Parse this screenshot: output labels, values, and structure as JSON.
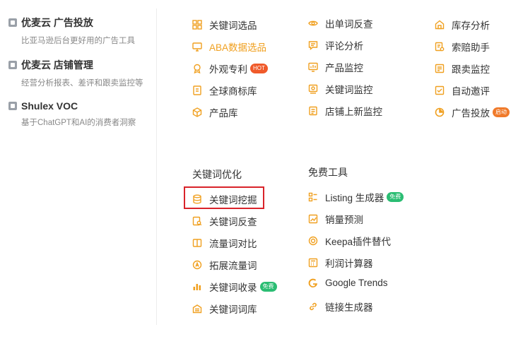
{
  "left_products": [
    {
      "name": "优麦云 广告投放",
      "desc": "比亚马逊后台更好用的广告工具",
      "icon": "u-logo-icon"
    },
    {
      "name": "优麦云 店铺管理",
      "desc": "经营分析报表、差评和跟卖监控等",
      "icon": "store-icon"
    },
    {
      "name": "Shulex VOC",
      "desc": "基于ChatGPT和AI的消费者洞察",
      "icon": "voc-icon"
    }
  ],
  "menu_col1": [
    {
      "label": "关键词选品",
      "icon": "grid-icon"
    },
    {
      "label": "ABA数据选品",
      "icon": "monitor-icon",
      "highlight": true
    },
    {
      "label": "外观专利",
      "icon": "award-icon",
      "badge": "HOT",
      "badge_color": "#f05a2a"
    },
    {
      "label": "全球商标库",
      "icon": "trademark-icon"
    },
    {
      "label": "产品库",
      "icon": "cube-icon"
    }
  ],
  "menu_col2": [
    {
      "label": "出单词反查",
      "icon": "eye-icon"
    },
    {
      "label": "评论分析",
      "icon": "comment-icon"
    },
    {
      "label": "产品监控",
      "icon": "chart-monitor-icon"
    },
    {
      "label": "关键词监控",
      "icon": "screen-icon"
    },
    {
      "label": "店铺上新监控",
      "icon": "shop-new-icon"
    }
  ],
  "menu_col3": [
    {
      "label": "库存分析",
      "icon": "warehouse-icon"
    },
    {
      "label": "索赔助手",
      "icon": "claim-icon"
    },
    {
      "label": "跟卖监控",
      "icon": "follow-icon"
    },
    {
      "label": "自动邀评",
      "icon": "invite-icon"
    },
    {
      "label": "广告投放",
      "icon": "pie-icon",
      "badge": "启动",
      "badge_color": "#f07a2a"
    }
  ],
  "section_keyword": {
    "title": "关键词优化",
    "items": [
      {
        "label": "关键词挖掘",
        "icon": "database-icon",
        "selected": true
      },
      {
        "label": "关键词反查",
        "icon": "search-doc-icon"
      },
      {
        "label": "流量词对比",
        "icon": "compare-icon"
      },
      {
        "label": "拓展流量词",
        "icon": "expand-icon"
      },
      {
        "label": "关键词收录",
        "icon": "bar-chart-icon",
        "badge": "免费",
        "badge_color": "#2bbd73"
      },
      {
        "label": "关键词词库",
        "icon": "library-icon"
      }
    ]
  },
  "section_free": {
    "title": "免费工具",
    "items": [
      {
        "label": "Listing 生成器",
        "icon": "list-icon",
        "badge": "免费",
        "badge_color": "#2bbd73"
      },
      {
        "label": "销量预测",
        "icon": "forecast-icon"
      },
      {
        "label": "Keepa插件替代",
        "icon": "plugin-icon"
      },
      {
        "label": "利润计算器",
        "icon": "calculator-icon"
      },
      {
        "label": "Google Trends",
        "icon": "google-icon"
      },
      {
        "label": "链接生成器",
        "icon": "link-icon"
      }
    ]
  },
  "colors": {
    "icon": "#f0a020",
    "highlight_text": "#f0a020",
    "selection_border": "#d9232a"
  }
}
